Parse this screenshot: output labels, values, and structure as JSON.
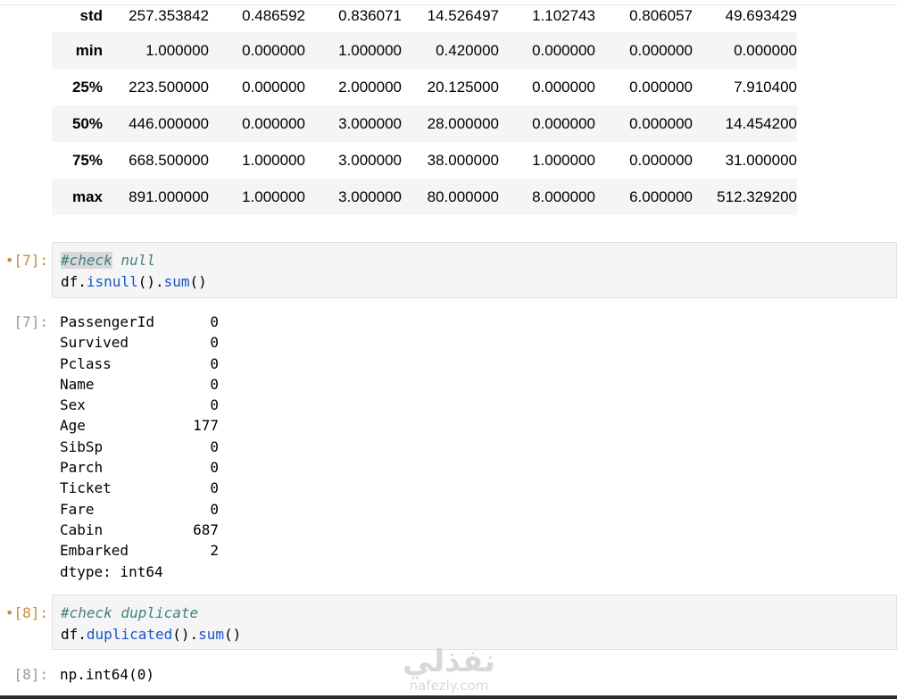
{
  "describe": {
    "rows": [
      {
        "label": "std",
        "values": [
          "257.353842",
          "0.486592",
          "0.836071",
          "14.526497",
          "1.102743",
          "0.806057",
          "49.693429"
        ]
      },
      {
        "label": "min",
        "values": [
          "1.000000",
          "0.000000",
          "1.000000",
          "0.420000",
          "0.000000",
          "0.000000",
          "0.000000"
        ]
      },
      {
        "label": "25%",
        "values": [
          "223.500000",
          "0.000000",
          "2.000000",
          "20.125000",
          "0.000000",
          "0.000000",
          "7.910400"
        ]
      },
      {
        "label": "50%",
        "values": [
          "446.000000",
          "0.000000",
          "3.000000",
          "28.000000",
          "0.000000",
          "0.000000",
          "14.454200"
        ]
      },
      {
        "label": "75%",
        "values": [
          "668.500000",
          "1.000000",
          "3.000000",
          "38.000000",
          "1.000000",
          "0.000000",
          "31.000000"
        ]
      },
      {
        "label": "max",
        "values": [
          "891.000000",
          "1.000000",
          "3.000000",
          "80.000000",
          "8.000000",
          "6.000000",
          "512.329200"
        ]
      }
    ]
  },
  "cell7": {
    "in_prompt": "•[7]:",
    "comment_hl": "#check",
    "comment_rest": " null",
    "code_obj": "df.",
    "code_fn1": "isnull",
    "code_mid": "().",
    "code_fn2": "sum",
    "code_end": "()",
    "out_prompt": "[7]:",
    "series": [
      {
        "name": "PassengerId",
        "value": "0"
      },
      {
        "name": "Survived",
        "value": "0"
      },
      {
        "name": "Pclass",
        "value": "0"
      },
      {
        "name": "Name",
        "value": "0"
      },
      {
        "name": "Sex",
        "value": "0"
      },
      {
        "name": "Age",
        "value": "177"
      },
      {
        "name": "SibSp",
        "value": "0"
      },
      {
        "name": "Parch",
        "value": "0"
      },
      {
        "name": "Ticket",
        "value": "0"
      },
      {
        "name": "Fare",
        "value": "0"
      },
      {
        "name": "Cabin",
        "value": "687"
      },
      {
        "name": "Embarked",
        "value": "2"
      }
    ],
    "dtype": "dtype: int64"
  },
  "cell8": {
    "in_prompt": "•[8]:",
    "comment": "#check duplicate",
    "code_obj": "df.",
    "code_fn1": "duplicated",
    "code_mid": "().",
    "code_fn2": "sum",
    "code_end": "()",
    "out_prompt": "[8]:",
    "output": "np.int64(0)"
  },
  "watermark": {
    "arabic": "نفذلي",
    "latin": "nafezly.com"
  }
}
